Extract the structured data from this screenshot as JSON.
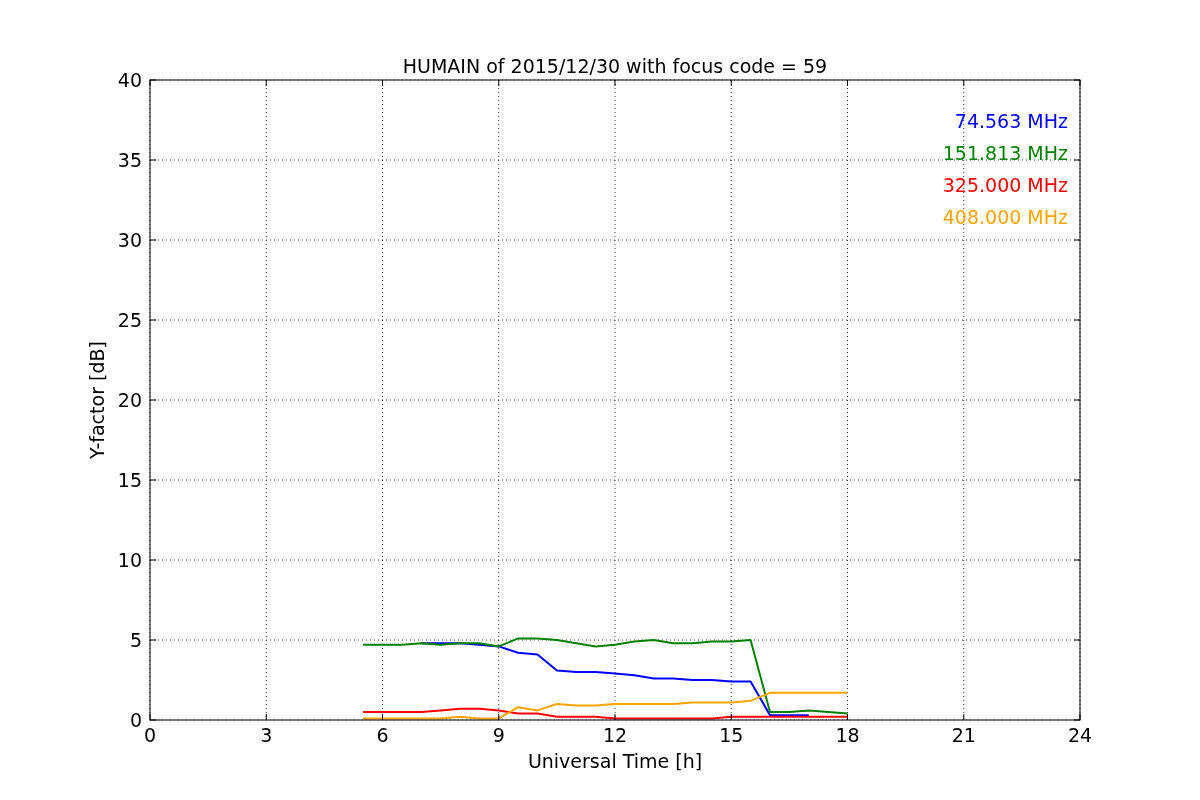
{
  "chart_data": {
    "type": "line",
    "title": "HUMAIN of 2015/12/30 with focus code = 59",
    "xlabel": "Universal Time [h]",
    "ylabel": "Y-factor [dB]",
    "x": [
      5.5,
      6,
      6.5,
      7,
      7.5,
      8,
      8.5,
      9,
      9.5,
      10,
      10.5,
      11,
      11.5,
      12,
      12.5,
      13,
      13.5,
      14,
      14.5,
      15,
      15.5,
      16,
      16.5,
      17,
      17.5,
      18
    ],
    "series": [
      {
        "name": "74.563 MHz",
        "color": "#0000ff",
        "values": [
          null,
          null,
          null,
          4.8,
          4.8,
          4.8,
          4.7,
          4.6,
          4.2,
          4.1,
          3.1,
          3.0,
          3.0,
          2.9,
          2.8,
          2.6,
          2.6,
          2.5,
          2.5,
          2.4,
          2.4,
          0.3,
          0.3,
          0.3,
          null,
          null
        ]
      },
      {
        "name": "151.813 MHz",
        "color": "#008000",
        "values": [
          4.7,
          4.7,
          4.7,
          4.8,
          4.7,
          4.8,
          4.8,
          4.6,
          5.1,
          5.1,
          5.0,
          4.8,
          4.6,
          4.7,
          4.9,
          5.0,
          4.8,
          4.8,
          4.9,
          4.9,
          5.0,
          0.5,
          0.5,
          0.6,
          0.5,
          0.4
        ]
      },
      {
        "name": "325.000 MHz",
        "color": "#ff0000",
        "values": [
          0.5,
          0.5,
          0.5,
          0.5,
          0.6,
          0.7,
          0.7,
          0.6,
          0.4,
          0.4,
          0.2,
          0.2,
          0.2,
          0.1,
          0.1,
          0.1,
          0.1,
          0.1,
          0.1,
          0.2,
          0.2,
          0.2,
          0.2,
          0.2,
          0.2,
          0.2
        ]
      },
      {
        "name": "408.000 MHz",
        "color": "#ffa500",
        "values": [
          0.1,
          0.1,
          0.1,
          0.1,
          0.1,
          0.2,
          0.1,
          0.1,
          0.8,
          0.6,
          1.0,
          0.9,
          0.9,
          1.0,
          1.0,
          1.0,
          1.0,
          1.1,
          1.1,
          1.1,
          1.2,
          1.7,
          1.7,
          1.7,
          1.7,
          1.7
        ]
      }
    ],
    "xlim": [
      0,
      24
    ],
    "grid": true,
    "ylim": [
      0,
      40
    ],
    "xticks": [
      0,
      3,
      6,
      9,
      12,
      15,
      18,
      21,
      24
    ],
    "yticks": [
      0,
      5,
      10,
      15,
      20,
      25,
      30,
      35,
      40
    ]
  }
}
